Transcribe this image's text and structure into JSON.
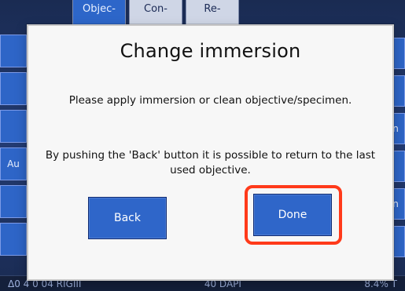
{
  "background": {
    "tabs": [
      {
        "label": "Objec-",
        "active": true
      },
      {
        "label": "Con-",
        "active": false
      },
      {
        "label": "Re-",
        "active": false
      }
    ],
    "left_items": [
      "",
      "",
      "",
      "Au",
      "",
      "",
      ""
    ],
    "right_items": [
      "",
      "",
      "n",
      "",
      "n",
      ""
    ],
    "status": {
      "left": "Δ0 4 0 04 RIGIII",
      "center": "40 DAPI",
      "right": "8.4% T"
    }
  },
  "dialog": {
    "title": "Change immersion",
    "message_1": "Please apply immersion or clean objective/specimen.",
    "message_2": "By pushing the 'Back' button it is possible to return to the last used objective.",
    "buttons": {
      "back": "Back",
      "done": "Done"
    }
  },
  "colors": {
    "dialog_bg": "#f7f7f7",
    "button_blue": "#2f66c9",
    "highlight_red": "#ff3a1a"
  }
}
